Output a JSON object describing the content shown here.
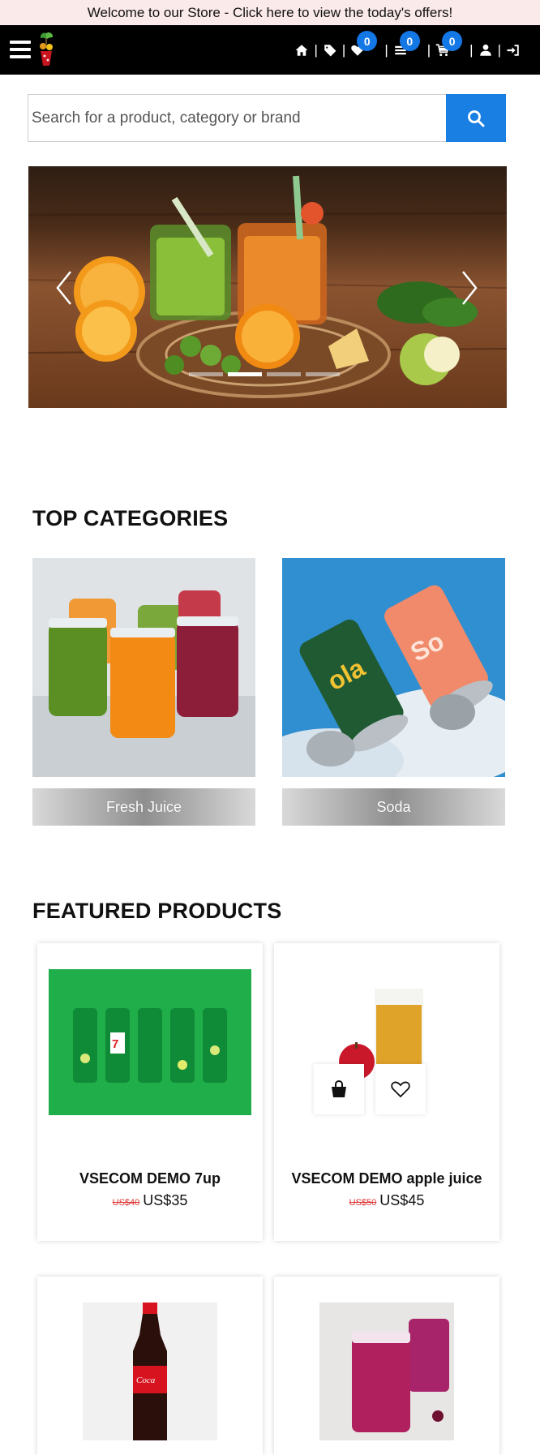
{
  "promo_banner": "Welcome to our Store - Click here to view the today's offers!",
  "nav": {
    "wishlist_count": "0",
    "list_count": "0",
    "cart_count": "0",
    "separator": "|"
  },
  "search": {
    "placeholder": "Search for a product, category or brand"
  },
  "hero": {
    "slide_count": 4,
    "active_slide": 2
  },
  "categories": {
    "title": "TOP CATEGORIES",
    "items": [
      {
        "label": "Fresh Juice"
      },
      {
        "label": "Soda"
      }
    ]
  },
  "featured": {
    "title": "FEATURED PRODUCTS",
    "products": [
      {
        "name": "VSECOM DEMO 7up",
        "old_price": "US$40",
        "price": "US$35"
      },
      {
        "name": "VSECOM DEMO apple juice",
        "old_price": "US$50",
        "price": "US$45"
      },
      {
        "name": "",
        "old_price": "",
        "price": ""
      },
      {
        "name": "",
        "old_price": "",
        "price": ""
      }
    ]
  },
  "colors": {
    "accent": "#1a7fe3",
    "navbar": "#000000",
    "promo_bg": "#fbeaea",
    "old_price": "#dd3333"
  }
}
